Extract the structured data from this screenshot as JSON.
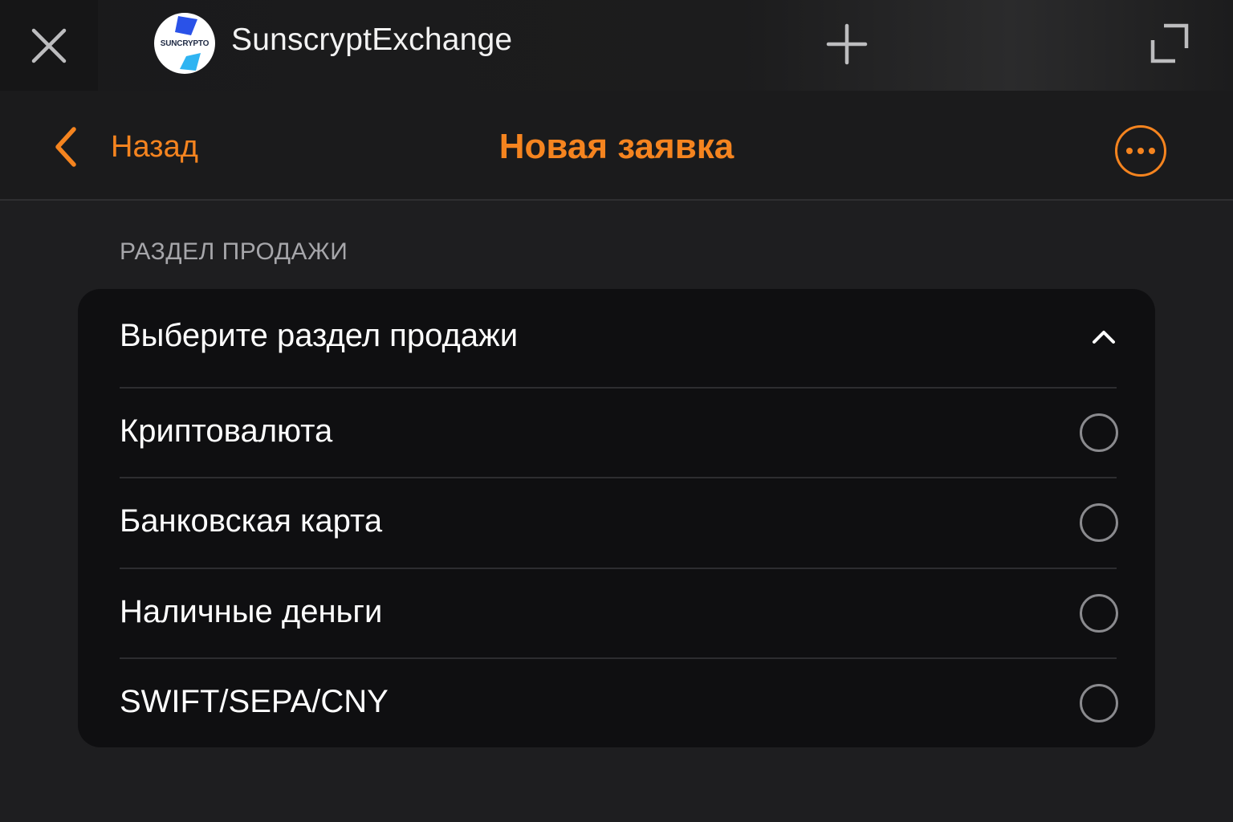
{
  "topbar": {
    "title": "SunscryptExchange",
    "logo_text": "SUNCRYPTO",
    "icons": [
      "close-icon",
      "plus-icon",
      "expand-icon"
    ]
  },
  "navbar": {
    "back_label": "Назад",
    "title": "Новая заявка",
    "accent_color": "#f5841f"
  },
  "section": {
    "label": "РАЗДЕЛ ПРОДАЖИ",
    "dropdown_placeholder": "Выберите раздел продажи",
    "expanded": true,
    "options": [
      {
        "label": "Криптовалюта",
        "selected": false
      },
      {
        "label": "Банковская карта",
        "selected": false
      },
      {
        "label": "Наличные деньги",
        "selected": false
      },
      {
        "label": "SWIFT/SEPA/CNY",
        "selected": false
      }
    ]
  }
}
